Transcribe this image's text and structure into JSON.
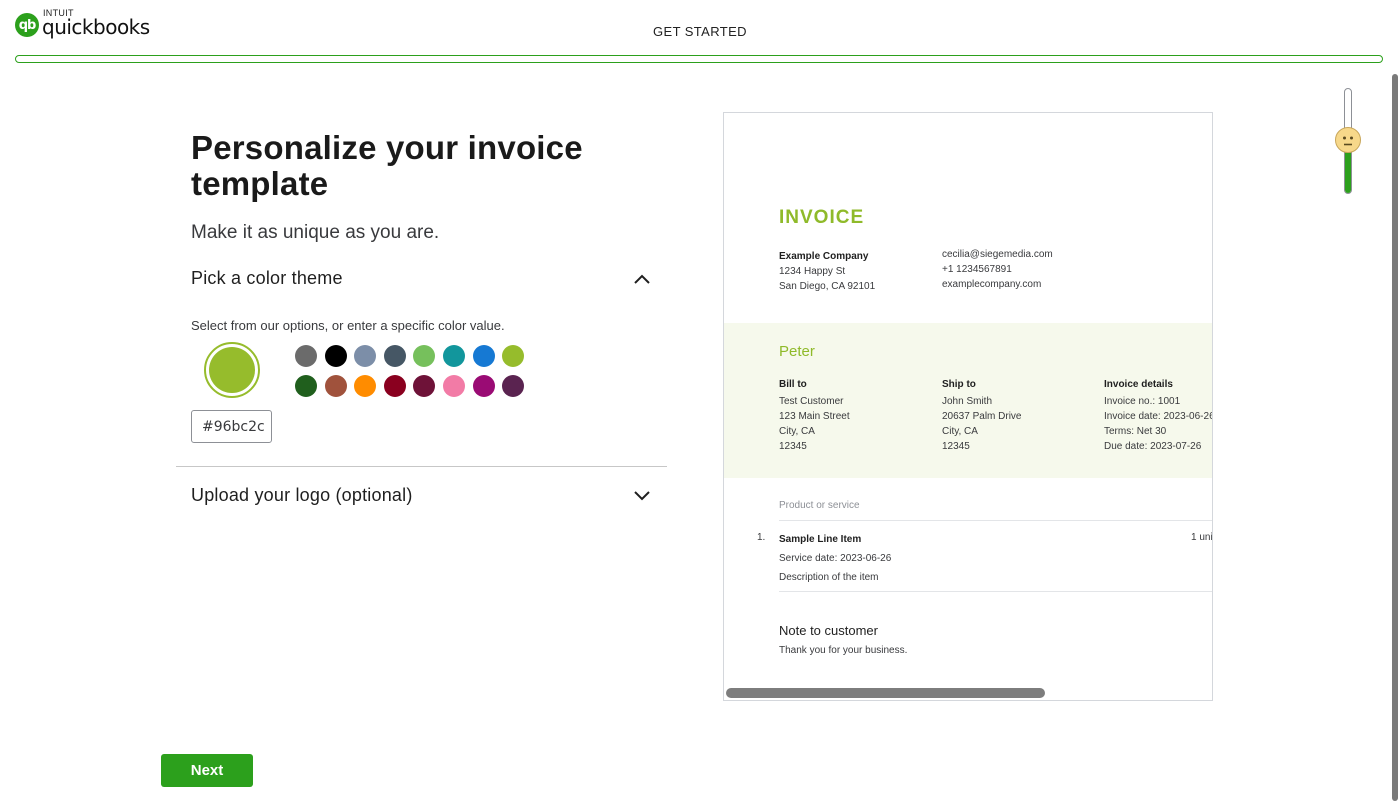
{
  "header": {
    "logo_intuit": "INTUIT",
    "logo_name": "quickbooks",
    "title": "GET STARTED",
    "progress": 0
  },
  "main": {
    "title": "Personalize your invoice template",
    "subtitle": "Make it as unique as you are.",
    "color_section": {
      "label": "Pick a color theme",
      "hint": "Select from our options, or enter a specific color value.",
      "selected_color": "#96bc2c",
      "hex_value": "#96bc2c",
      "swatches": [
        "#6b6b6b",
        "#000000",
        "#7c8ea8",
        "#465765",
        "#76c05c",
        "#12969c",
        "#1679d3",
        "#96bc2c",
        "#205f1d",
        "#a0523c",
        "#ff8c00",
        "#8a001f",
        "#6e1238",
        "#f27ba6",
        "#9a0b74",
        "#5a2350"
      ]
    },
    "logo_section": {
      "label": "Upload your logo (optional)"
    },
    "next_label": "Next"
  },
  "preview": {
    "accent": "#8fba2a",
    "invoice_title": "INVOICE",
    "company": {
      "name": "Example Company",
      "address1": "1234 Happy St",
      "address2": "San Diego, CA 92101"
    },
    "contact": {
      "email": "cecilia@siegemedia.com",
      "phone": "+1 1234567891",
      "website": "examplecompany.com"
    },
    "customer_name": "Peter",
    "bill_to": {
      "label": "Bill to",
      "name": "Test Customer",
      "street": "123 Main Street",
      "city": "City, CA",
      "zip": "12345"
    },
    "ship_to": {
      "label": "Ship to",
      "name": "John Smith",
      "street": "20637 Palm Drive",
      "city": "City, CA",
      "zip": "12345"
    },
    "details": {
      "label": "Invoice details",
      "number": "Invoice no.: 1001",
      "date": "Invoice date: 2023-06-26",
      "terms": "Terms: Net 30",
      "due": "Due date: 2023-07-26"
    },
    "product_header": "Product or service",
    "line_item": {
      "index": "1.",
      "name": "Sample Line Item",
      "service_date": "Service date: 2023-06-26",
      "description": "Description of the item",
      "qty": "1 uni"
    },
    "note": {
      "title": "Note to customer",
      "text": "Thank you for your business."
    }
  },
  "feedback_slider": {
    "level": 0.5
  }
}
